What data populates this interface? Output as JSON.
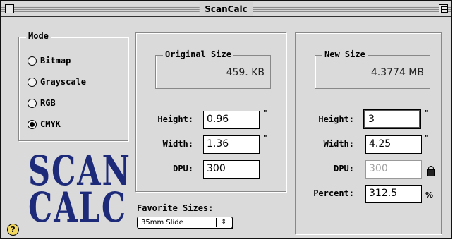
{
  "window": {
    "title": "ScanCalc"
  },
  "mode": {
    "label": "Mode",
    "options": [
      {
        "label": "Bitmap",
        "selected": false
      },
      {
        "label": "Grayscale",
        "selected": false
      },
      {
        "label": "RGB",
        "selected": false
      },
      {
        "label": "CMYK",
        "selected": true
      }
    ]
  },
  "logo": {
    "line1": "SCAN",
    "line2": "CALC",
    "color": "#1d2a7a"
  },
  "help": {
    "label": "?"
  },
  "original": {
    "size_label": "Original Size",
    "size_value": "459. KB",
    "height_label": "Height:",
    "height_value": "0.96",
    "height_unit": "\"",
    "width_label": "Width:",
    "width_value": "1.36",
    "width_unit": "\"",
    "dpu_label": "DPU:",
    "dpu_value": "300"
  },
  "new": {
    "size_label": "New Size",
    "size_value": "4.3774 MB",
    "height_label": "Height:",
    "height_value": "3",
    "height_unit": "\"",
    "width_label": "Width:",
    "width_value": "4.25",
    "width_unit": "\"",
    "dpu_label": "DPU:",
    "dpu_value": "300",
    "percent_label": "Percent:",
    "percent_value": "312.5",
    "percent_unit": "%"
  },
  "favorites": {
    "label": "Favorite Sizes:",
    "selected": "35mm Slide",
    "arrow": "⇕"
  }
}
